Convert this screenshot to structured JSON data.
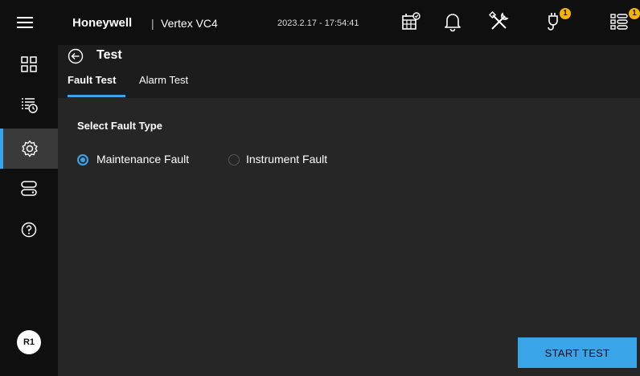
{
  "header": {
    "brand": "Honeywell",
    "separator": "|",
    "model": "Vertex VC4",
    "datetime": "2023.2.17 - 17:54:41",
    "icons": [
      "menu-icon",
      "calendar-check-icon",
      "bell-icon",
      "tools-icon",
      "plug-alert-icon",
      "list-alert-icon"
    ],
    "plug_badge": "1",
    "list_badge": "1"
  },
  "sidebar": {
    "items": [
      {
        "icon": "dashboard-grid-icon"
      },
      {
        "icon": "event-history-icon"
      },
      {
        "icon": "settings-gear-icon",
        "active": true
      },
      {
        "icon": "storage-icon"
      },
      {
        "icon": "help-icon"
      }
    ],
    "user_initials": "R1"
  },
  "page": {
    "title": "Test",
    "tabs": [
      {
        "label": "Fault Test",
        "active": true
      },
      {
        "label": "Alarm Test",
        "active": false
      }
    ],
    "section_title": "Select Fault Type",
    "options": [
      {
        "label": "Maintenance Fault",
        "selected": true
      },
      {
        "label": "Instrument Fault",
        "selected": false
      }
    ],
    "start_button": "START TEST"
  },
  "colors": {
    "accent": "#3aa4e8",
    "badge": "#f6b300",
    "background": "#262626",
    "bar": "#0f0f0f"
  }
}
